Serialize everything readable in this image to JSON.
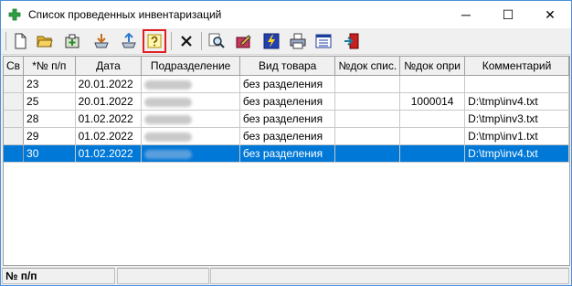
{
  "window": {
    "title": "Список проведенных инвентаризаций",
    "minimize": "─",
    "maximize": "☐",
    "close": "✕"
  },
  "toolbar": {
    "buttons": [
      {
        "icon": "new-document-icon"
      },
      {
        "icon": "open-folder-icon"
      },
      {
        "icon": "add-item-icon"
      },
      {
        "icon": "import-down-icon"
      },
      {
        "icon": "export-up-icon"
      },
      {
        "icon": "help-query-icon",
        "selected": true
      },
      {
        "icon": "delete-x-icon"
      },
      {
        "icon": "search-magnifier-icon"
      },
      {
        "icon": "edit-pencil-icon"
      },
      {
        "icon": "execute-lightning-icon"
      },
      {
        "icon": "print-icon"
      },
      {
        "icon": "list-view-icon"
      },
      {
        "icon": "exit-door-icon"
      }
    ],
    "highlight_color": "#e02020"
  },
  "grid": {
    "columns": [
      "Св",
      "*№ п/п",
      "Дата",
      "Подразделение",
      "Вид товара",
      "№док спис.",
      "№док опри",
      "Комментарий"
    ],
    "rows": [
      {
        "num": "23",
        "date": "20.01.2022",
        "dept": "",
        "kind": "без разделения",
        "doc1": "",
        "doc2": "",
        "comment": ""
      },
      {
        "num": "25",
        "date": "20.01.2022",
        "dept": "",
        "kind": "без разделения",
        "doc1": "",
        "doc2": "1000014",
        "comment": "D:\\tmp\\inv4.txt"
      },
      {
        "num": "28",
        "date": "01.02.2022",
        "dept": "",
        "kind": "без разделения",
        "doc1": "",
        "doc2": "",
        "comment": "D:\\tmp\\inv3.txt"
      },
      {
        "num": "29",
        "date": "01.02.2022",
        "dept": "",
        "kind": "без разделения",
        "doc1": "",
        "doc2": "",
        "comment": "D:\\tmp\\inv1.txt"
      },
      {
        "num": "30",
        "date": "01.02.2022",
        "dept": "",
        "kind": "без разделения",
        "doc1": "",
        "doc2": "",
        "comment": "D:\\tmp\\inv4.txt",
        "selected": true
      }
    ],
    "selection_color": "#0078d7"
  },
  "status": {
    "field1": "№ п/п",
    "field2": "",
    "field3": ""
  }
}
